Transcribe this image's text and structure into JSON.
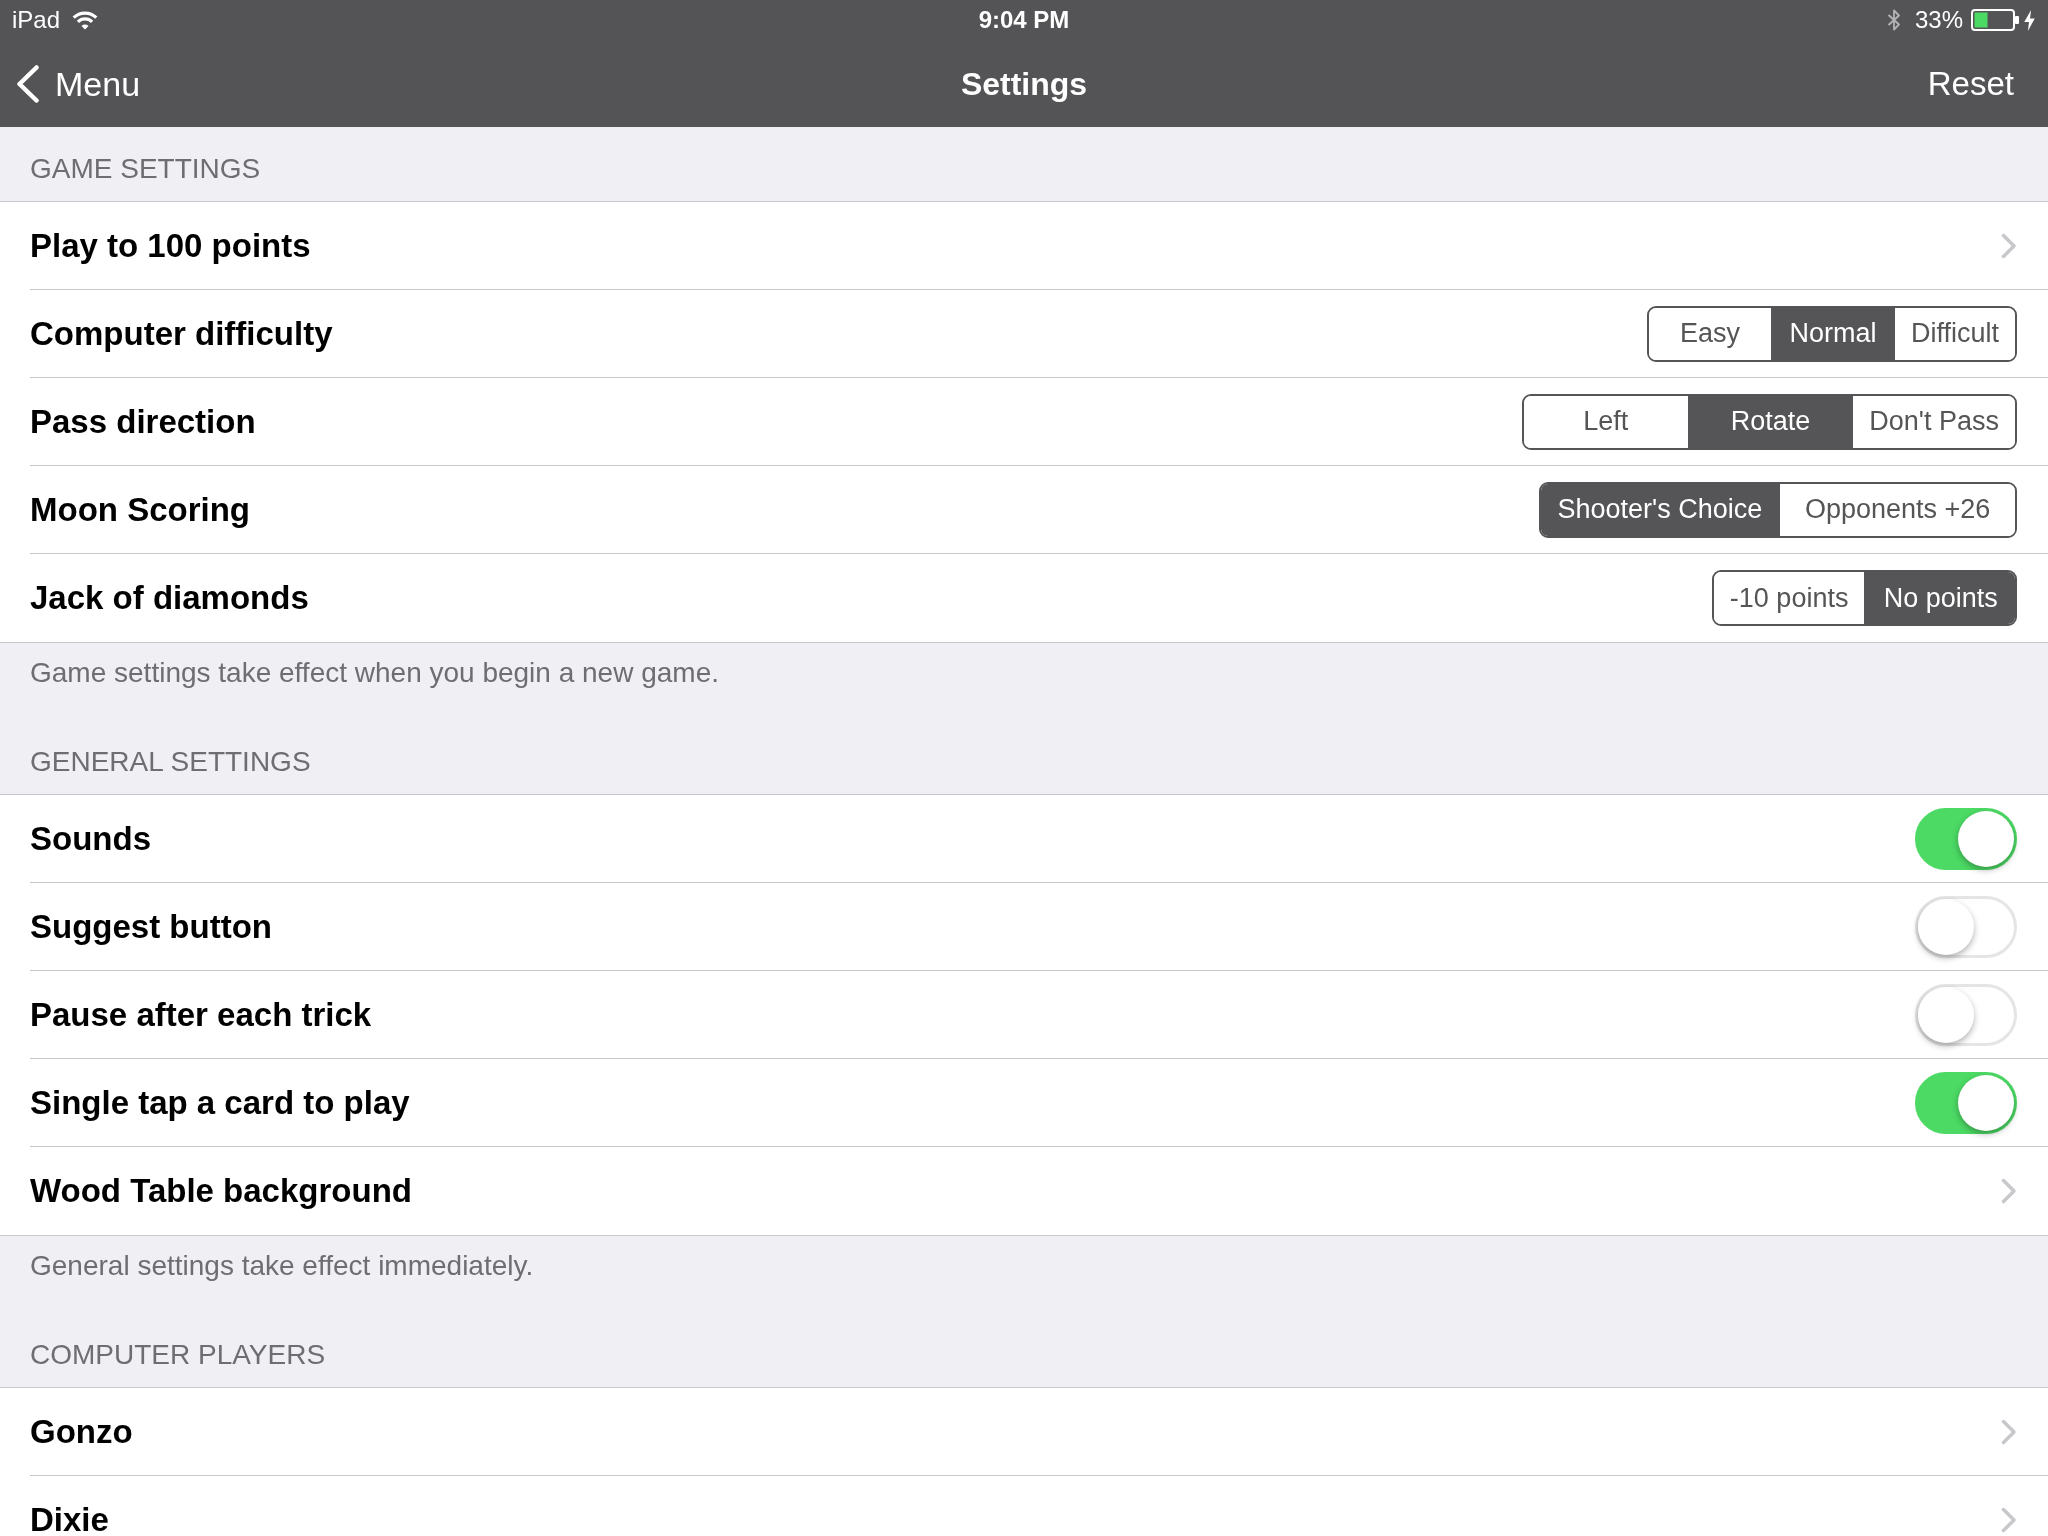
{
  "status_bar": {
    "carrier": "iPad",
    "time": "9:04 PM",
    "battery": "33%"
  },
  "nav_bar": {
    "back": "Menu",
    "title": "Settings",
    "action": "Reset"
  },
  "sections": [
    {
      "header": "GAME SETTINGS",
      "rows": [
        {
          "kind": "disclosure",
          "label": "Play to 100 points"
        },
        {
          "kind": "segmented",
          "label": "Computer difficulty",
          "options": [
            {
              "label": "Easy",
              "selected": false
            },
            {
              "label": "Normal",
              "selected": true
            },
            {
              "label": "Difficult",
              "selected": false
            }
          ]
        },
        {
          "kind": "segmented",
          "label": "Pass direction",
          "options": [
            {
              "label": "Left",
              "selected": false
            },
            {
              "label": "Rotate",
              "selected": true
            },
            {
              "label": "Don't Pass",
              "selected": false
            }
          ]
        },
        {
          "kind": "segmented",
          "label": "Moon Scoring",
          "options": [
            {
              "label": "Shooter's Choice",
              "selected": true
            },
            {
              "label": "Opponents +26",
              "selected": false
            }
          ]
        },
        {
          "kind": "segmented",
          "label": "Jack of diamonds",
          "options": [
            {
              "label": "-10 points",
              "selected": false
            },
            {
              "label": "No points",
              "selected": true
            }
          ]
        }
      ],
      "footer": "Game settings take effect when you begin a new game."
    },
    {
      "header": "GENERAL SETTINGS",
      "rows": [
        {
          "kind": "switch",
          "label": "Sounds",
          "on": true
        },
        {
          "kind": "switch",
          "label": "Suggest button",
          "on": false
        },
        {
          "kind": "switch",
          "label": "Pause after each trick",
          "on": false
        },
        {
          "kind": "switch",
          "label": "Single tap a card to play",
          "on": true
        },
        {
          "kind": "disclosure",
          "label": "Wood Table background"
        }
      ],
      "footer": "General settings take effect immediately."
    },
    {
      "header": "COMPUTER PLAYERS",
      "rows": [
        {
          "kind": "disclosure",
          "label": "Gonzo"
        },
        {
          "kind": "disclosure",
          "label": "Dixie"
        }
      ]
    }
  ]
}
